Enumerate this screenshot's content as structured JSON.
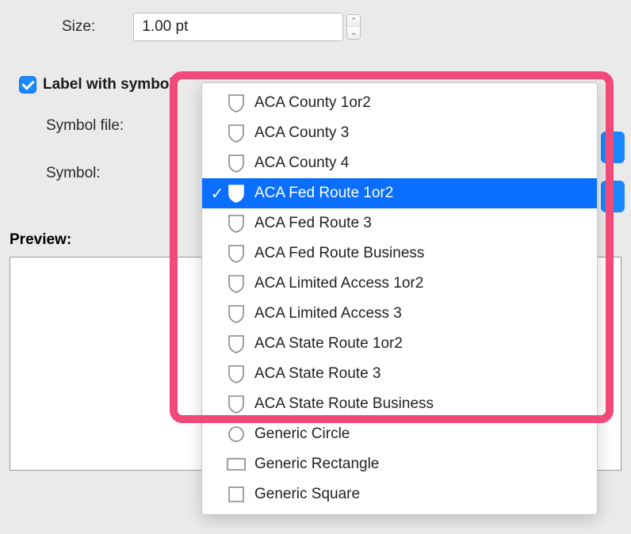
{
  "size": {
    "label": "Size:",
    "value": "1.00 pt"
  },
  "labelWithSymbol": {
    "checked": true,
    "label": "Label with symbol"
  },
  "symbolFile": {
    "label": "Symbol file:"
  },
  "symbol": {
    "label": "Symbol:"
  },
  "preview": {
    "label": "Preview:"
  },
  "dropdown": {
    "items": [
      {
        "name": "ACA County 1or2",
        "icon": "shield-outline",
        "selected": false
      },
      {
        "name": "ACA County 3",
        "icon": "shield-outline",
        "selected": false
      },
      {
        "name": "ACA County 4",
        "icon": "shield-outline",
        "selected": false
      },
      {
        "name": "ACA Fed Route 1or2",
        "icon": "shield-filled",
        "selected": true
      },
      {
        "name": "ACA Fed Route 3",
        "icon": "shield-outline",
        "selected": false
      },
      {
        "name": "ACA Fed Route Business",
        "icon": "shield-outline",
        "selected": false
      },
      {
        "name": "ACA Limited Access 1or2",
        "icon": "shield-outline",
        "selected": false
      },
      {
        "name": "ACA Limited Access 3",
        "icon": "shield-outline",
        "selected": false
      },
      {
        "name": "ACA State Route 1or2",
        "icon": "shield-outline",
        "selected": false
      },
      {
        "name": "ACA State Route 3",
        "icon": "shield-outline",
        "selected": false
      },
      {
        "name": "ACA State Route Business",
        "icon": "shield-outline",
        "selected": false
      },
      {
        "name": "Generic Circle",
        "icon": "circle",
        "selected": false
      },
      {
        "name": "Generic Rectangle",
        "icon": "rectangle",
        "selected": false
      },
      {
        "name": "Generic Square",
        "icon": "square",
        "selected": false
      }
    ]
  }
}
